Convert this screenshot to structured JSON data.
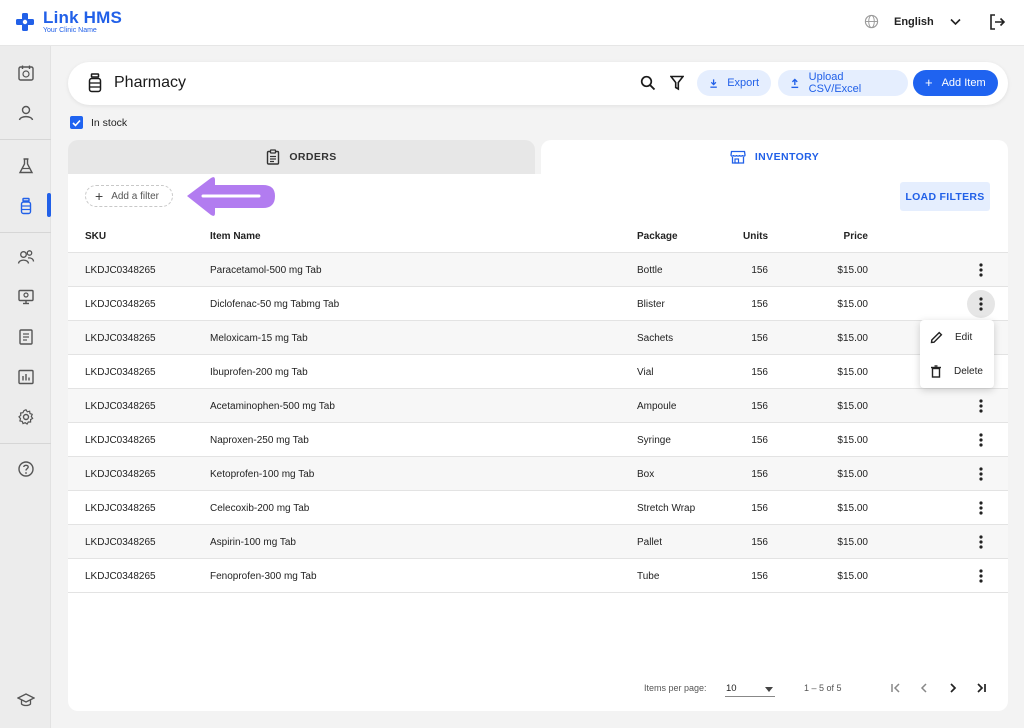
{
  "app": {
    "name": "Link HMS",
    "subtitle": "Your Clinic Name",
    "language": "English"
  },
  "colors": {
    "primary": "#1f63f0",
    "accent_light": "#e5eefe",
    "annotation_arrow": "#b27cf0"
  },
  "sidebar": {
    "items": [
      {
        "icon": "calendar-icon"
      },
      {
        "icon": "user-icon"
      },
      {
        "icon": "lab-flask-icon"
      },
      {
        "icon": "pharmacy-bottle-icon",
        "active": true
      },
      {
        "icon": "group-icon"
      },
      {
        "icon": "monitor-icon"
      },
      {
        "icon": "report-icon"
      },
      {
        "icon": "chart-icon"
      },
      {
        "icon": "gear-icon"
      },
      {
        "icon": "help-icon"
      },
      {
        "icon": "graduation-cap-icon"
      }
    ]
  },
  "header": {
    "title": "Pharmacy",
    "export_label": "Export",
    "upload_label": "Upload CSV/Excel",
    "add_label": "Add Item"
  },
  "filters": {
    "in_stock_label": "In stock",
    "in_stock_checked": true,
    "add_filter_label": "Add a filter",
    "load_filters_label": "LOAD FILTERS"
  },
  "tabs": [
    {
      "label": "ORDERS",
      "active": false
    },
    {
      "label": "INVENTORY",
      "active": true
    }
  ],
  "table": {
    "columns": [
      "SKU",
      "Item Name",
      "Package",
      "Units",
      "Price"
    ],
    "rows": [
      {
        "sku": "LKDJC0348265",
        "name": "Paracetamol-500 mg Tab",
        "package": "Bottle",
        "units": "156",
        "price": "$15.00"
      },
      {
        "sku": "LKDJC0348265",
        "name": "Diclofenac-50 mg Tabmg Tab",
        "package": "Blister",
        "units": "156",
        "price": "$15.00"
      },
      {
        "sku": "LKDJC0348265",
        "name": "Meloxicam-15 mg Tab",
        "package": "Sachets",
        "units": "156",
        "price": "$15.00"
      },
      {
        "sku": "LKDJC0348265",
        "name": "Ibuprofen-200 mg Tab",
        "package": "Vial",
        "units": "156",
        "price": "$15.00"
      },
      {
        "sku": "LKDJC0348265",
        "name": "Acetaminophen-500 mg Tab",
        "package": "Ampoule",
        "units": "156",
        "price": "$15.00"
      },
      {
        "sku": "LKDJC0348265",
        "name": "Naproxen-250 mg Tab",
        "package": "Syringe",
        "units": "156",
        "price": "$15.00"
      },
      {
        "sku": "LKDJC0348265",
        "name": "Ketoprofen-100 mg Tab",
        "package": "Box",
        "units": "156",
        "price": "$15.00"
      },
      {
        "sku": "LKDJC0348265",
        "name": "Celecoxib-200 mg Tab",
        "package": "Stretch Wrap",
        "units": "156",
        "price": "$15.00"
      },
      {
        "sku": "LKDJC0348265",
        "name": "Aspirin-100 mg Tab",
        "package": "Pallet",
        "units": "156",
        "price": "$15.00"
      },
      {
        "sku": "LKDJC0348265",
        "name": "Fenoprofen-300 mg Tab",
        "package": "Tube",
        "units": "156",
        "price": "$15.00"
      }
    ]
  },
  "row_menu": {
    "edit_label": "Edit",
    "delete_label": "Delete"
  },
  "pagination": {
    "per_page_label": "Items per page:",
    "per_page_value": "10",
    "range_label": "1 – 5 of 5"
  }
}
